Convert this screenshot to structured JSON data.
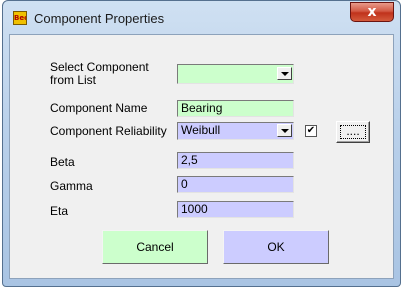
{
  "window": {
    "title": "Component Properties",
    "close_label": "x"
  },
  "form": {
    "select_component_label": "Select Component from List",
    "select_component_value": "",
    "component_name_label": "Component Name",
    "component_name_value": "Bearing",
    "reliability_label": "Component Reliability",
    "reliability_value": "Weibull",
    "reliability_checked": "✔",
    "browse_label": "....",
    "beta_label": "Beta",
    "beta_value": "2,5",
    "gamma_label": "Gamma",
    "gamma_value": "0",
    "eta_label": "Eta",
    "eta_value": "1000"
  },
  "buttons": {
    "cancel": "Cancel",
    "ok": "OK"
  },
  "colors": {
    "green_field": "#ccffcc",
    "lavender_field": "#ccccff"
  }
}
